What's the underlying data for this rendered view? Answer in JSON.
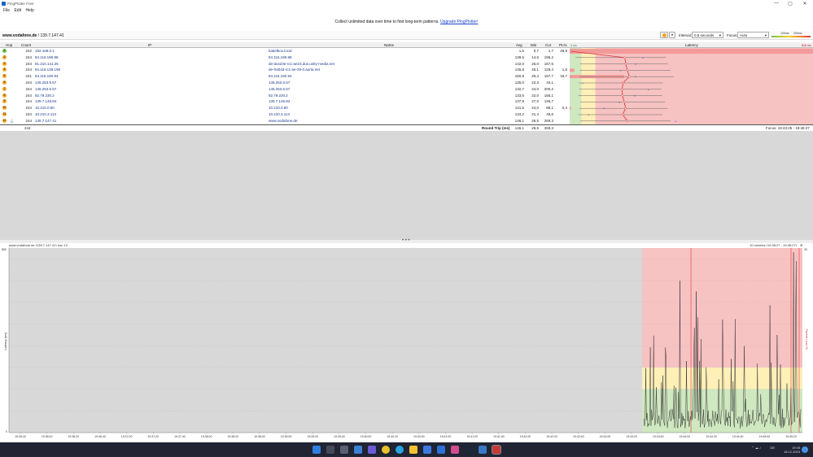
{
  "window": {
    "title": "PingPlotter Free",
    "controls": [
      "—",
      "▢",
      "✕"
    ]
  },
  "menu": [
    "File",
    "Edit",
    "Help"
  ],
  "promo": {
    "text": "Collect unlimited data over time to find long-term patterns.",
    "link": "Upgrade PingPlotter!"
  },
  "target": {
    "host": "www.vodafone.de",
    "ip": " / 139.7.147.41"
  },
  "controls": {
    "interval_label": "Interval:",
    "interval_value": "0,5 seconds",
    "focus_label": "Focus:",
    "focus_value": "Auto",
    "scale_left": "100ms",
    "scale_right": "200ms"
  },
  "table": {
    "headers": {
      "hop": "Hop",
      "count": "Count",
      "ip": "IP",
      "name": "Name",
      "avg": "Avg",
      "min": "Min",
      "cur": "Cur",
      "pl": "PL%",
      "latency": "Latency",
      "lat_min": "0 ms",
      "lat_max": "616 ms"
    },
    "rows": [
      {
        "hop": "1",
        "count": "242",
        "ip": "192.168.0.1",
        "name": "kabelbox.local",
        "avg": "1,5",
        "min": "0,7",
        "cur": "1,7",
        "pl": "48,8",
        "color": "#6cc24a"
      },
      {
        "hop": "2",
        "count": "244",
        "ip": "84.116.198.88",
        "name": "84.116.198.88",
        "avg": "139,5",
        "min": "14,6",
        "cur": "186,2",
        "pl": "",
        "color": "#f5a623"
      },
      {
        "hop": "3",
        "count": "244",
        "ip": "81.210.141.25",
        "name": "de-dus23e-rc1-ae23.dus.unity-media.net",
        "avg": "142,0",
        "min": "26,0",
        "cur": "167,6",
        "pl": "",
        "color": "#f5a623"
      },
      {
        "hop": "4",
        "count": "244",
        "ip": "84.116.138.198",
        "name": "de-fra04d-rc1-ae-29-0.aorta.net",
        "avg": "145,8",
        "min": "25,1",
        "cur": "129,4",
        "pl": "1,6",
        "color": "#f5a623"
      },
      {
        "hop": "5",
        "count": "241",
        "ip": "84.116.190.94",
        "name": "84.116.190.94",
        "avg": "150,8",
        "min": "25,4",
        "cur": "167,7",
        "pl": "18,7",
        "color": "#f5a623"
      },
      {
        "hop": "6",
        "count": "244",
        "ip": "145.253.5.57",
        "name": "145.253.5.57",
        "avg": "135,0",
        "min": "22,3",
        "cur": "34,1",
        "pl": "",
        "color": "#f5a623"
      },
      {
        "hop": "7",
        "count": "244",
        "ip": "145.253.5.57",
        "name": "145.253.5.57",
        "avg": "132,7",
        "min": "24,0",
        "cur": "200,2",
        "pl": "",
        "color": "#f5a623"
      },
      {
        "hop": "8",
        "count": "244",
        "ip": "92.79.230.2",
        "name": "92.79.230.2",
        "avg": "133,6",
        "min": "22,0",
        "cur": "165,1",
        "pl": "",
        "color": "#f5a623"
      },
      {
        "hop": "9",
        "count": "244",
        "ip": "139.7.148.84",
        "name": "139.7.148.84",
        "avg": "137,9",
        "min": "27,0",
        "cur": "126,7",
        "pl": "",
        "color": "#f5a623"
      },
      {
        "hop": "10",
        "count": "244",
        "ip": "10.210.0.50",
        "name": "10.210.0.50",
        "avg": "141,5",
        "min": "24,0",
        "cur": "88,1",
        "pl": "0,4",
        "color": "#f5a623"
      },
      {
        "hop": "11",
        "count": "244",
        "ip": "10.210.3.113",
        "name": "10.210.3.113",
        "avg": "134,2",
        "min": "21,4",
        "cur": "48,6",
        "pl": "",
        "color": "#f5a623"
      },
      {
        "hop": "12",
        "count": "244",
        "ip": "139.7.147.41",
        "name": "www.vodafone.de",
        "avg": "146,1",
        "min": "26,5",
        "cur": "269,3",
        "pl": "",
        "color": "#f5a623"
      }
    ],
    "summary": {
      "count": "244",
      "label": "Round Trip (ms)",
      "avg": "146,1",
      "min": "26,5",
      "cur": "269,3",
      "focus": "Focus: 19:43:25 - 19:45:27"
    }
  },
  "graph": {
    "title": "www.vodafone.de (139.7.147.41) hop 12",
    "range": "10 minutes (19:35:27 - 19:45:27)",
    "ylabel": "Latency (ms)",
    "y2label": "Packet Loss %",
    "ymax": "850",
    "y2max": "30",
    "y0": "0",
    "times": [
      "19:35:40",
      "19:36:00",
      "19:36:20",
      "19:36:40",
      "19:37:00",
      "19:37:20",
      "19:37:40",
      "19:38:00",
      "19:38:20",
      "19:38:40",
      "19:39:00",
      "19:39:20",
      "19:39:40",
      "19:40:00",
      "19:40:20",
      "19:40:40",
      "19:41:00",
      "19:41:20",
      "19:41:40",
      "19:42:00",
      "19:42:20",
      "19:42:40",
      "19:43:00",
      "19:43:20",
      "19:43:40",
      "19:44:00",
      "19:44:20",
      "19:44:40",
      "19:45:00",
      "19:45:20"
    ]
  },
  "taskbar": {
    "time": "19:45",
    "date": "18.12.2023",
    "lang": "DE"
  },
  "colors": {
    "good": "#cfe8c0",
    "warn": "#fff0b8",
    "bad": "#f7c2c2",
    "badstrong": "#f29a9a",
    "hop_accent": "#f5a623"
  }
}
